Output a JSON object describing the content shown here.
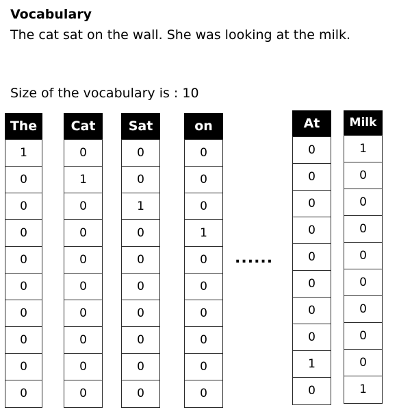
{
  "heading": "Vocabulary",
  "sentence": "The cat sat on the wall. She was looking at the milk.",
  "size_line": "Size of the vocabulary is : 10",
  "ellipsis": "......",
  "columns": [
    {
      "header": "The",
      "values": [
        "1",
        "0",
        "0",
        "0",
        "0",
        "0",
        "0",
        "0",
        "0",
        "0"
      ]
    },
    {
      "header": "Cat",
      "values": [
        "0",
        "1",
        "0",
        "0",
        "0",
        "0",
        "0",
        "0",
        "0",
        "0"
      ]
    },
    {
      "header": "Sat",
      "values": [
        "0",
        "0",
        "1",
        "0",
        "0",
        "0",
        "0",
        "0",
        "0",
        "0"
      ]
    },
    {
      "header": "on",
      "values": [
        "0",
        "0",
        "0",
        "1",
        "0",
        "0",
        "0",
        "0",
        "0",
        "0"
      ]
    },
    {
      "header": "At",
      "values": [
        "0",
        "0",
        "0",
        "0",
        "0",
        "0",
        "0",
        "0",
        "1",
        "0"
      ]
    },
    {
      "header": "Milk",
      "values": [
        "1",
        "0",
        "0",
        "0",
        "0",
        "0",
        "0",
        "0",
        "0",
        "1"
      ]
    }
  ]
}
